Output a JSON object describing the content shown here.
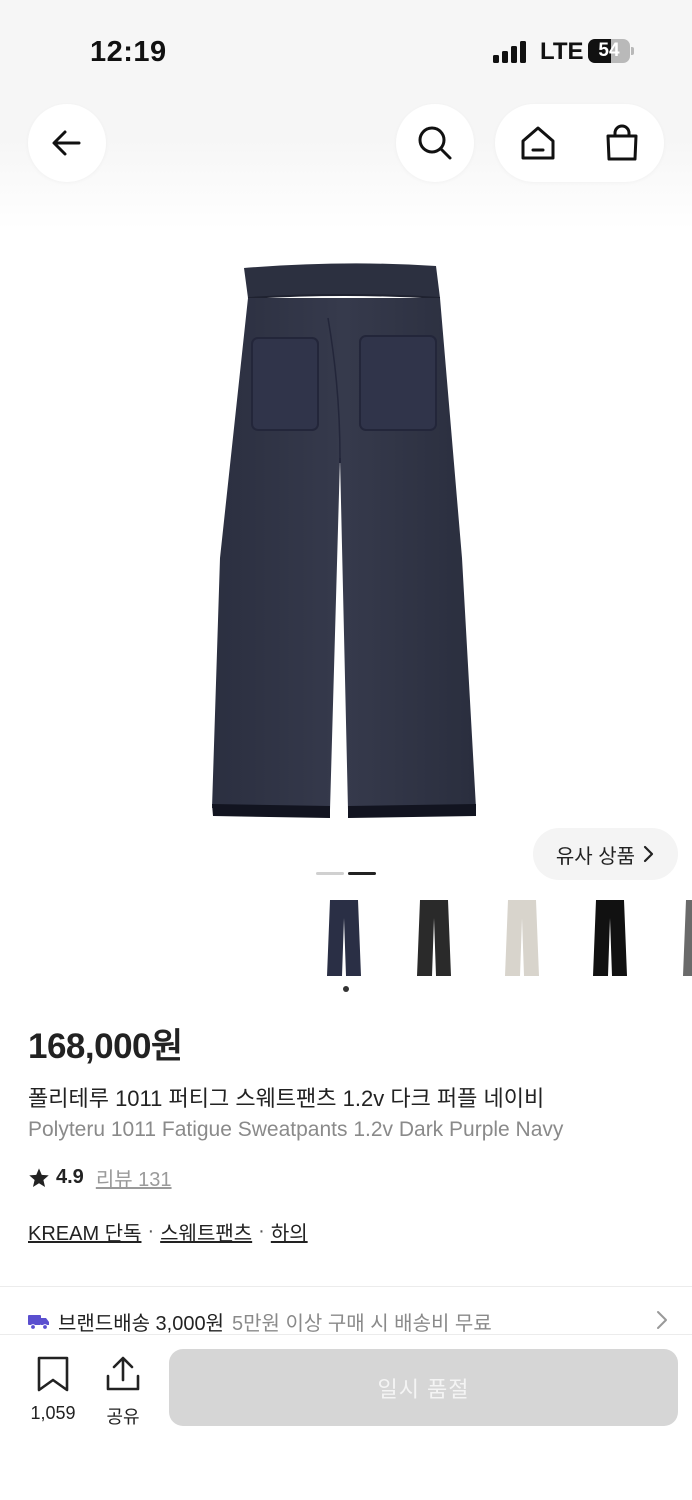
{
  "status": {
    "time": "12:19",
    "network": "LTE",
    "battery": "54",
    "battery_level_percent": 54
  },
  "header": {
    "back_icon": "arrow-left-icon",
    "search_icon": "search-icon",
    "home_icon": "home-icon",
    "cart_icon": "shopping-bag-icon"
  },
  "gallery": {
    "similar_label": "유사 상품",
    "page_count": 2,
    "active_page": 2,
    "thumb_colors": [
      "#2a2f45",
      "#2a2a2a",
      "#d8d4cc",
      "#111111",
      "#6a6a6a"
    ]
  },
  "product": {
    "price": "168,000원",
    "title_ko": "폴리테루 1011 퍼티그 스웨트팬츠 1.2v 다크 퍼플 네이비",
    "title_en": "Polyteru 1011 Fatigue Sweatpants 1.2v Dark Purple Navy",
    "rating": "4.9",
    "review_label": "리뷰 131",
    "tags": [
      "KREAM 단독",
      "스웨트팬츠",
      "하의"
    ],
    "tag_separator": "·"
  },
  "shipping": {
    "icon": "truck-icon",
    "title": "브랜드배송 3,000원",
    "note": "5만원 이상 구매 시 배송비 무료",
    "accent": "#5a4fcf"
  },
  "bottom": {
    "bookmark_icon": "bookmark-icon",
    "bookmark_count": "1,059",
    "share_icon": "share-icon",
    "share_label": "공유",
    "cta_label": "일시 품절"
  }
}
